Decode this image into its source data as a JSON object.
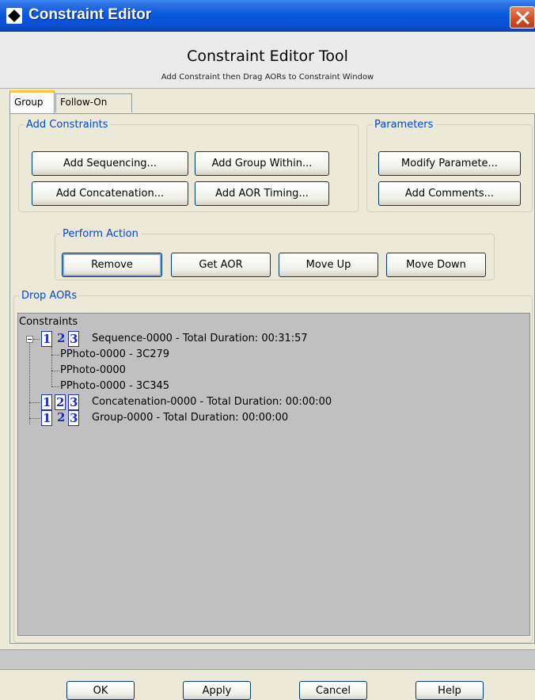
{
  "window": {
    "title": "Constraint Editor"
  },
  "header": {
    "title": "Constraint Editor Tool",
    "subtitle": "Add Constraint then Drag AORs to Constraint Window"
  },
  "tabs": [
    {
      "label": "Group",
      "active": true
    },
    {
      "label": "Follow-On",
      "active": false
    }
  ],
  "add_constraints": {
    "legend": "Add Constraints",
    "buttons": [
      "Add Sequencing...",
      "Add Group Within...",
      "Add Concatenation...",
      "Add AOR Timing..."
    ]
  },
  "parameters": {
    "legend": "Parameters",
    "buttons": [
      "Modify Paramete...",
      "Add Comments..."
    ]
  },
  "perform_action": {
    "legend": "Perform Action",
    "buttons": [
      "Remove",
      "Get AOR",
      "Move Up",
      "Move Down"
    ]
  },
  "drop_aors": {
    "legend": "Drop AORs",
    "root": "Constraints",
    "nodes": [
      {
        "label": "Sequence-0000 - Total Duration: 00:31:57",
        "children": [
          "PPhoto-0000 - 3C279",
          "PPhoto-0000",
          "PPhoto-0000 - 3C345"
        ]
      },
      {
        "label": "Concatenation-0000 - Total Duration: 00:00:00"
      },
      {
        "label": "Group-0000 - Total Duration: 00:00:00"
      }
    ],
    "icon_digits": [
      "1",
      "2",
      "3"
    ]
  },
  "footer": {
    "buttons": [
      "OK",
      "Apply",
      "Cancel",
      "Help"
    ]
  },
  "colors": {
    "titlebar": "#0a58de",
    "legend": "#0046d5",
    "tree_bg": "#c0c0c0",
    "icon_blue": "#1a2bd0"
  }
}
